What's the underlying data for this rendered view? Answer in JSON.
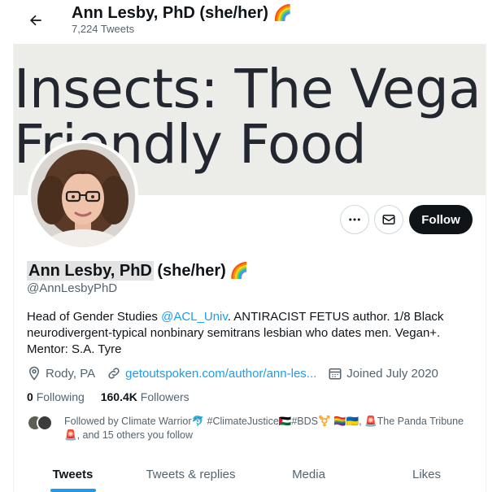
{
  "header": {
    "display_name": "Ann Lesby, PhD (she/her)",
    "name_emoji": "🌈",
    "tweet_count": "7,224 Tweets"
  },
  "banner": {
    "line1": "Insects: The Vegan",
    "line2": "Friendly Food"
  },
  "actions": {
    "more_glyph": "•••",
    "follow_label": "Follow"
  },
  "profile": {
    "name": "Ann Lesby, PhD",
    "pronouns": "(she/her)",
    "name_emoji": "🌈",
    "handle": "@AnnLesbyPhD",
    "bio": {
      "line1_prefix": "Head of Gender Studies ",
      "line1_mention": "@ACL_Univ",
      "line1_suffix": ". ANTIRACIST FETUS author. 1/8 Black",
      "line2": "neurodivergent-typical nonbinary semitrans lesbian who dates men. Vegan+.",
      "line3": "Mentor: S.A. Tyre"
    },
    "location": "Rody, PA",
    "website": "getoutspoken.com/author/ann-les...",
    "joined": "Joined July 2020"
  },
  "stats": {
    "following_count": "0",
    "following_label": "Following",
    "followers_count": "160.4K",
    "followers_label": "Followers"
  },
  "followed_by": {
    "line1": "Followed by Climate Warrior🐬 #ClimateJustice🇵🇸#BDS⚧️ 🏳️‍🌈🇺🇦, 🚨The Panda Tribune",
    "line2": "🚨, and 15 others you follow"
  },
  "tabs": [
    {
      "label": "Tweets",
      "active": true
    },
    {
      "label": "Tweets & replies",
      "active": false
    },
    {
      "label": "Media",
      "active": false
    },
    {
      "label": "Likes",
      "active": false
    }
  ],
  "colors": {
    "accent": "#1d9bf0",
    "text_primary": "#0f1419",
    "text_secondary": "#536471",
    "follow_button": "#0f1419",
    "banner_background": "#ecede8"
  },
  "icons": [
    "back-arrow-icon",
    "more-icon",
    "mail-icon",
    "location-pin-icon",
    "link-icon",
    "calendar-icon"
  ]
}
